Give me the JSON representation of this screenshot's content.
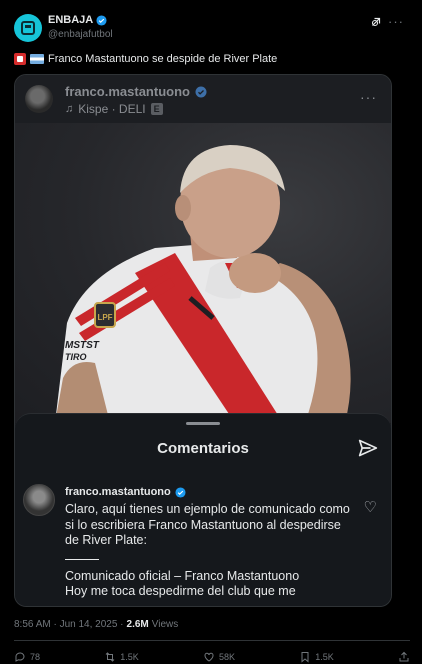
{
  "tweet": {
    "display_name": "ENBAJA",
    "handle": "@enbajafutbol",
    "text": "Franco Mastantuono se despide de River Plate",
    "timestamp": "8:56 AM · Jun 14, 2025 · ",
    "views_count": "2.6M",
    "views_label": "Views"
  },
  "media": {
    "ig_username": "franco.mastantuono",
    "music": "Kispe · DELI",
    "explicit_badge": "E",
    "comments_title": "Comentarios",
    "comment": {
      "username": "franco.mastantuono",
      "intro": "Claro, aquí tienes un ejemplo de comunicado como si lo escribiera Franco Mastantuono al despedirse de River Plate:",
      "heading": "Comunicado oficial – Franco Mastantuono",
      "line": "Hoy me toca despedirme del club que me"
    }
  },
  "actions": {
    "replies": "78",
    "reposts": "1.5K",
    "likes": "58K",
    "bookmarks": "1.5K"
  },
  "colors": {
    "background": "#000000",
    "accent": "#1d9bf0",
    "muted": "#71767b"
  }
}
